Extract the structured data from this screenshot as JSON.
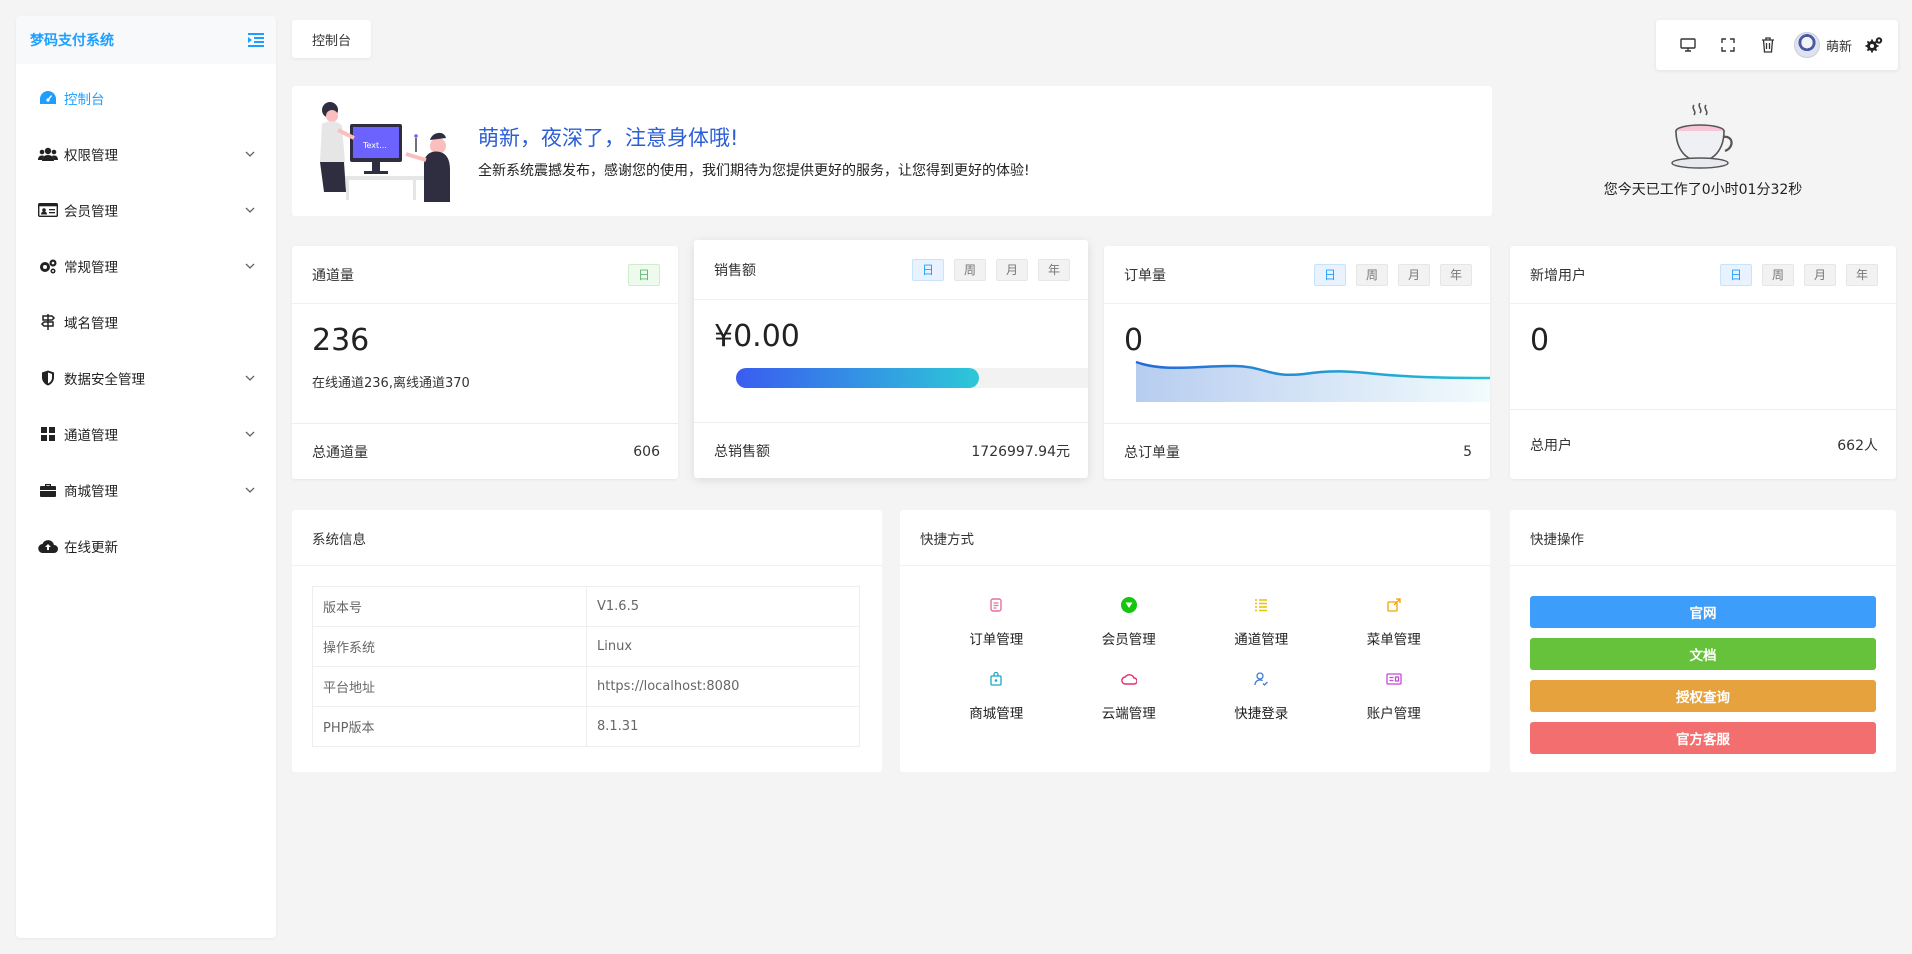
{
  "brand": {
    "title": "梦码支付系统"
  },
  "sidebar": {
    "items": [
      {
        "label": "控制台",
        "icon": "dashboard-icon",
        "active": true,
        "expandable": false
      },
      {
        "label": "权限管理",
        "icon": "users-icon",
        "expandable": true
      },
      {
        "label": "会员管理",
        "icon": "id-card-icon",
        "expandable": true
      },
      {
        "label": "常规管理",
        "icon": "gears-icon",
        "expandable": true
      },
      {
        "label": "域名管理",
        "icon": "signpost-icon",
        "expandable": false
      },
      {
        "label": "数据安全管理",
        "icon": "shield-icon",
        "expandable": true
      },
      {
        "label": "通道管理",
        "icon": "grid-icon",
        "expandable": true
      },
      {
        "label": "商城管理",
        "icon": "briefcase-icon",
        "expandable": true
      },
      {
        "label": "在线更新",
        "icon": "cloud-upload-icon",
        "expandable": false
      }
    ]
  },
  "tabs": {
    "current": "控制台"
  },
  "toolbar": {
    "user_name": "萌新"
  },
  "welcome": {
    "title": "萌新，夜深了，注意身体哦!",
    "subtitle": "全新系统震撼发布，感谢您的使用，我们期待为您提供更好的服务，让您得到更好的体验!",
    "illustration_text": "Text..."
  },
  "worktime": {
    "text": "您今天已工作了0小时01分32秒"
  },
  "stats": {
    "channels": {
      "title": "通道量",
      "pill": "日",
      "value": "236",
      "detail": "在线通道236,离线通道370",
      "foot_label": "总通道量",
      "foot_value": "606"
    },
    "sales": {
      "title": "销售额",
      "pills": [
        "日",
        "周",
        "月",
        "年"
      ],
      "value": "¥0.00",
      "progress": 0.69,
      "foot_label": "总销售额",
      "foot_value": "1726997.94元"
    },
    "orders": {
      "title": "订单量",
      "pills": [
        "日",
        "周",
        "月",
        "年"
      ],
      "value": "0",
      "foot_label": "总订单量",
      "foot_value": "5"
    },
    "users": {
      "title": "新增用户",
      "pills": [
        "日",
        "周",
        "月",
        "年"
      ],
      "value": "0",
      "foot_label": "总用户",
      "foot_value": "662人"
    }
  },
  "system_info": {
    "title": "系统信息",
    "rows": [
      {
        "key": "版本号",
        "value": "V1.6.5"
      },
      {
        "key": "操作系统",
        "value": "Linux"
      },
      {
        "key": "平台地址",
        "value": "https://localhost:8080"
      },
      {
        "key": "PHP版本",
        "value": "8.1.31"
      }
    ]
  },
  "shortcuts": {
    "title": "快捷方式",
    "items": [
      {
        "label": "订单管理",
        "icon": "order-icon",
        "color": "#e66fa0"
      },
      {
        "label": "会员管理",
        "icon": "member-icon",
        "color": "#16c60c"
      },
      {
        "label": "通道管理",
        "icon": "channel-list-icon",
        "color": "#e8c200"
      },
      {
        "label": "菜单管理",
        "icon": "menu-icon",
        "color": "#f0a300"
      },
      {
        "label": "商城管理",
        "icon": "shop-icon",
        "color": "#1aa7c4"
      },
      {
        "label": "云端管理",
        "icon": "cloud-icon",
        "color": "#e0316a"
      },
      {
        "label": "快捷登录",
        "icon": "login-user-icon",
        "color": "#3f7bd9"
      },
      {
        "label": "账户管理",
        "icon": "account-icon",
        "color": "#c24bd6"
      }
    ]
  },
  "quick_actions": {
    "title": "快捷操作",
    "buttons": [
      {
        "label": "官网",
        "color": "#3d9dfa"
      },
      {
        "label": "文档",
        "color": "#66c23a"
      },
      {
        "label": "授权查询",
        "color": "#e6a23c"
      },
      {
        "label": "官方客服",
        "color": "#f36f6f"
      }
    ]
  },
  "colors": {
    "accent": "#1e9fff",
    "welcome_title": "#2c5ed6"
  }
}
